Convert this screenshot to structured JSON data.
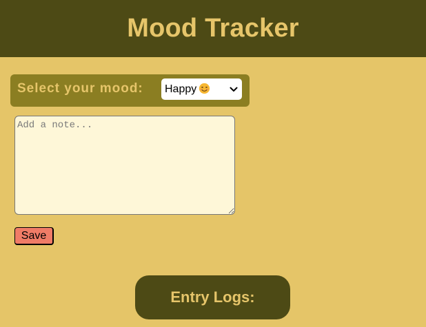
{
  "app": {
    "title": "Mood Tracker"
  },
  "mood": {
    "label": "Select your mood:",
    "selected": "Happy",
    "selected_icon": "smiling-face-emoji"
  },
  "note": {
    "placeholder": "Add a note...",
    "value": ""
  },
  "actions": {
    "save_label": "Save"
  },
  "logs": {
    "heading": "Entry Logs:"
  },
  "colors": {
    "background": "#e5c568",
    "header": "#4d4a15",
    "accent_text": "#e6c56a",
    "mood_panel": "#8b7e22",
    "textarea": "#fef7d8",
    "save_button": "#f07c67"
  }
}
